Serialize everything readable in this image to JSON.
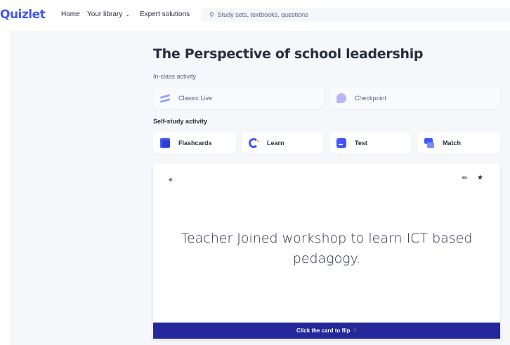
{
  "header": {
    "logo": "Quizlet",
    "nav": {
      "home": "Home",
      "library": "Your library",
      "expert": "Expert solutions"
    },
    "search": {
      "placeholder": "Study sets, textbooks, questions"
    }
  },
  "set": {
    "title": "The Perspective of school leadership"
  },
  "in_class": {
    "label": "In-class activity",
    "items": [
      {
        "label": "Classic Live",
        "icon": "classic-live-icon"
      },
      {
        "label": "Checkpoint",
        "icon": "checkpoint-icon"
      }
    ]
  },
  "self_study": {
    "label": "Self-study activity",
    "items": [
      {
        "label": "Flashcards",
        "icon": "flashcards-icon"
      },
      {
        "label": "Learn",
        "icon": "learn-icon"
      },
      {
        "label": "Test",
        "icon": "test-icon"
      },
      {
        "label": "Match",
        "icon": "match-icon"
      }
    ]
  },
  "flashcard": {
    "text": "Teacher Joined workshop to learn ICT based pedagogy.",
    "flip_hint": "Click the card to flip"
  },
  "colors": {
    "brand": "#4255ff",
    "flip_bar": "#24279a",
    "page_bg": "#f6f7fb"
  }
}
